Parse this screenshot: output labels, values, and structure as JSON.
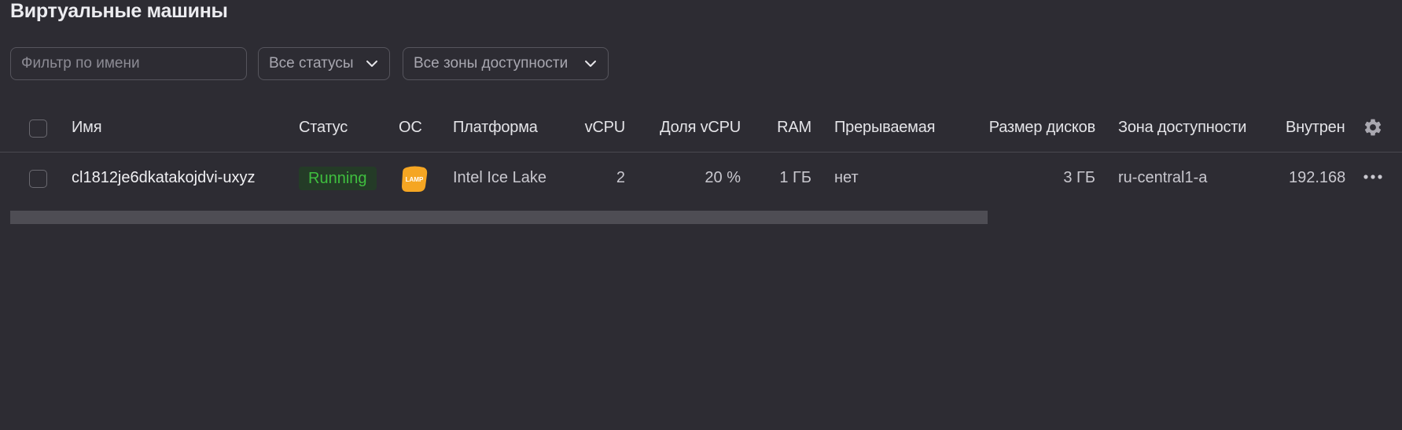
{
  "page": {
    "title": "Виртуальные машины"
  },
  "filters": {
    "search_placeholder": "Фильтр по имени",
    "status_select": "Все статусы",
    "zone_select": "Все зоны доступности"
  },
  "table": {
    "columns": {
      "name": "Имя",
      "status": "Статус",
      "os": "ОС",
      "platform": "Платформа",
      "vcpu": "vCPU",
      "vcpu_share": "Доля vCPU",
      "ram": "RAM",
      "preemptible": "Прерываемая",
      "disk_size": "Размер дисков",
      "zone": "Зона доступности",
      "internal_ip": "Внутрен"
    },
    "rows": [
      {
        "name": "cl1812je6dkatakojdvi-uxyz",
        "status": "Running",
        "os_badge": "LAMP",
        "platform": "Intel Ice Lake",
        "vcpu": "2",
        "vcpu_share": "20 %",
        "ram": "1 ГБ",
        "preemptible": "нет",
        "disk_size": "3 ГБ",
        "zone": "ru-central1-a",
        "internal_ip": "192.168"
      }
    ]
  },
  "colors": {
    "background": "#2d2c33",
    "status_running_text": "#3fbf3f",
    "status_running_bg": "#243b27",
    "lamp_icon": "#f5a623"
  },
  "icons": {
    "settings": "gear-icon",
    "row_actions": "more-horizontal-icon",
    "dropdown": "chevron-down-icon"
  }
}
